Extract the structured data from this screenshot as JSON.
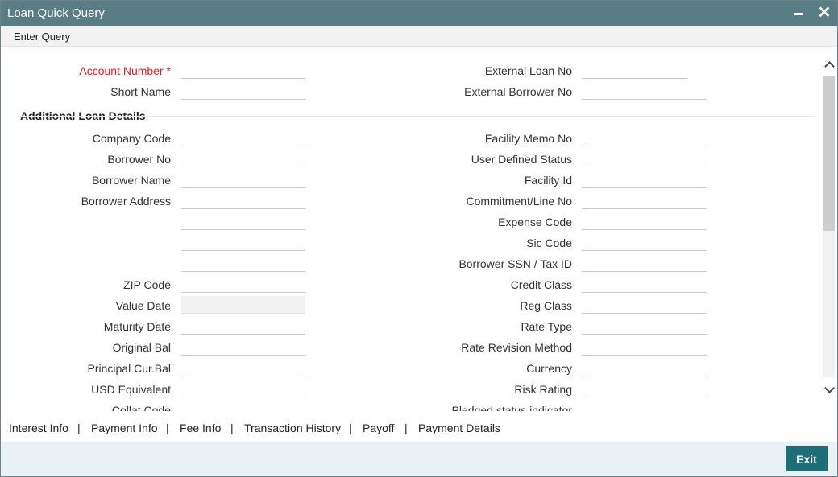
{
  "window": {
    "title": "Loan Quick Query"
  },
  "menu": {
    "enter_query": "Enter Query"
  },
  "form": {
    "account_number": {
      "label": "Account Number",
      "required_mark": "*",
      "value": ""
    },
    "short_name": {
      "label": "Short Name",
      "value": ""
    },
    "external_loan_no": {
      "label": "External Loan No",
      "value": ""
    },
    "external_borrower_no": {
      "label": "External Borrower No",
      "value": ""
    }
  },
  "additional": {
    "title": "Additional Loan Details",
    "left": [
      {
        "label": "Company Code",
        "value": ""
      },
      {
        "label": "Borrower No",
        "value": ""
      },
      {
        "label": "Borrower Name",
        "value": ""
      },
      {
        "label": "Borrower Address",
        "value": ""
      },
      {
        "label": "",
        "value": ""
      },
      {
        "label": "",
        "value": ""
      },
      {
        "label": "",
        "value": ""
      },
      {
        "label": "ZIP Code",
        "value": ""
      },
      {
        "label": "Value Date",
        "value": ""
      },
      {
        "label": "Maturity Date",
        "value": ""
      },
      {
        "label": "Original Bal",
        "value": ""
      },
      {
        "label": "Principal Cur.Bal",
        "value": ""
      },
      {
        "label": "USD Equivalent",
        "value": ""
      },
      {
        "label": "Collat Code",
        "value": ""
      }
    ],
    "right": [
      {
        "label": "Facility Memo No",
        "value": ""
      },
      {
        "label": "User Defined Status",
        "value": ""
      },
      {
        "label": "Facility Id",
        "value": ""
      },
      {
        "label": "Commitment/Line No",
        "value": ""
      },
      {
        "label": "Expense Code",
        "value": ""
      },
      {
        "label": "Sic Code",
        "value": ""
      },
      {
        "label": "Borrower SSN / Tax ID",
        "value": ""
      },
      {
        "label": "Credit Class",
        "value": ""
      },
      {
        "label": "Reg Class",
        "value": ""
      },
      {
        "label": "Rate Type",
        "value": ""
      },
      {
        "label": "Rate Revision Method",
        "value": ""
      },
      {
        "label": "Currency",
        "value": ""
      },
      {
        "label": "Risk Rating",
        "value": ""
      },
      {
        "label": "Pledged status indicator",
        "value": ""
      }
    ]
  },
  "tabs": [
    "Interest Info",
    "Payment Info",
    "Fee Info",
    "Transaction History",
    "Payoff",
    "Payment Details"
  ],
  "tab_separator": "|",
  "footer": {
    "exit_label": "Exit"
  },
  "colors": {
    "titlebar": "#587d84",
    "exit_button": "#1d6f77",
    "required": "#d22222",
    "footer": "#eaf1f4"
  }
}
